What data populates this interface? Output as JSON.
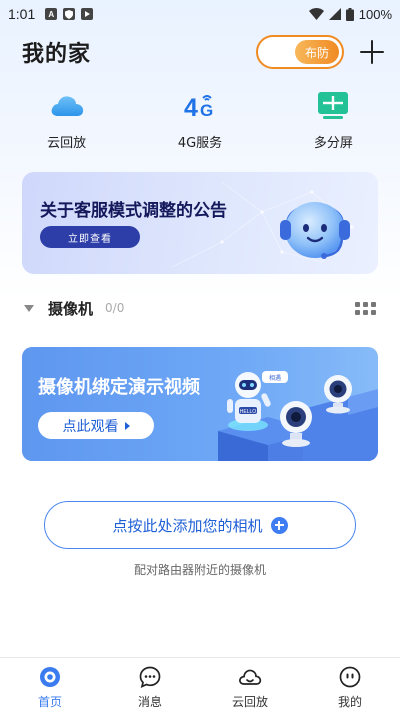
{
  "status_bar": {
    "time": "1:01",
    "notification_icons": [
      "A",
      "shield",
      "play"
    ],
    "battery": "100%"
  },
  "header": {
    "title": "我的家",
    "arm_toggle_label": "布防"
  },
  "quick_actions": [
    {
      "label": "云回放",
      "icon": "cloud-icon"
    },
    {
      "label": "4G服务",
      "icon": "4g-icon"
    },
    {
      "label": "多分屏",
      "icon": "multi-screen-icon"
    }
  ],
  "notice_banner": {
    "title": "关于客服模式调整的公告",
    "button": "立即查看"
  },
  "camera_section": {
    "title": "摄像机",
    "count": "0/0"
  },
  "tutorial_banner": {
    "title": "摄像机绑定演示视频",
    "button": "点此观看",
    "robot_badge": "HELLO",
    "bubble_text": "相遇"
  },
  "add_camera": {
    "button": "点按此处添加您的相机",
    "hint": "配对路由器附近的摄像机"
  },
  "bottom_nav": [
    {
      "label": "首页",
      "icon": "home-icon",
      "active": true
    },
    {
      "label": "消息",
      "icon": "message-icon",
      "active": false
    },
    {
      "label": "云回放",
      "icon": "cloud-playback-icon",
      "active": false
    },
    {
      "label": "我的",
      "icon": "profile-icon",
      "active": false
    }
  ],
  "colors": {
    "accent_blue": "#3a7cf0",
    "arm_orange": "#f08a23",
    "notice_button": "#2d3ea8"
  }
}
